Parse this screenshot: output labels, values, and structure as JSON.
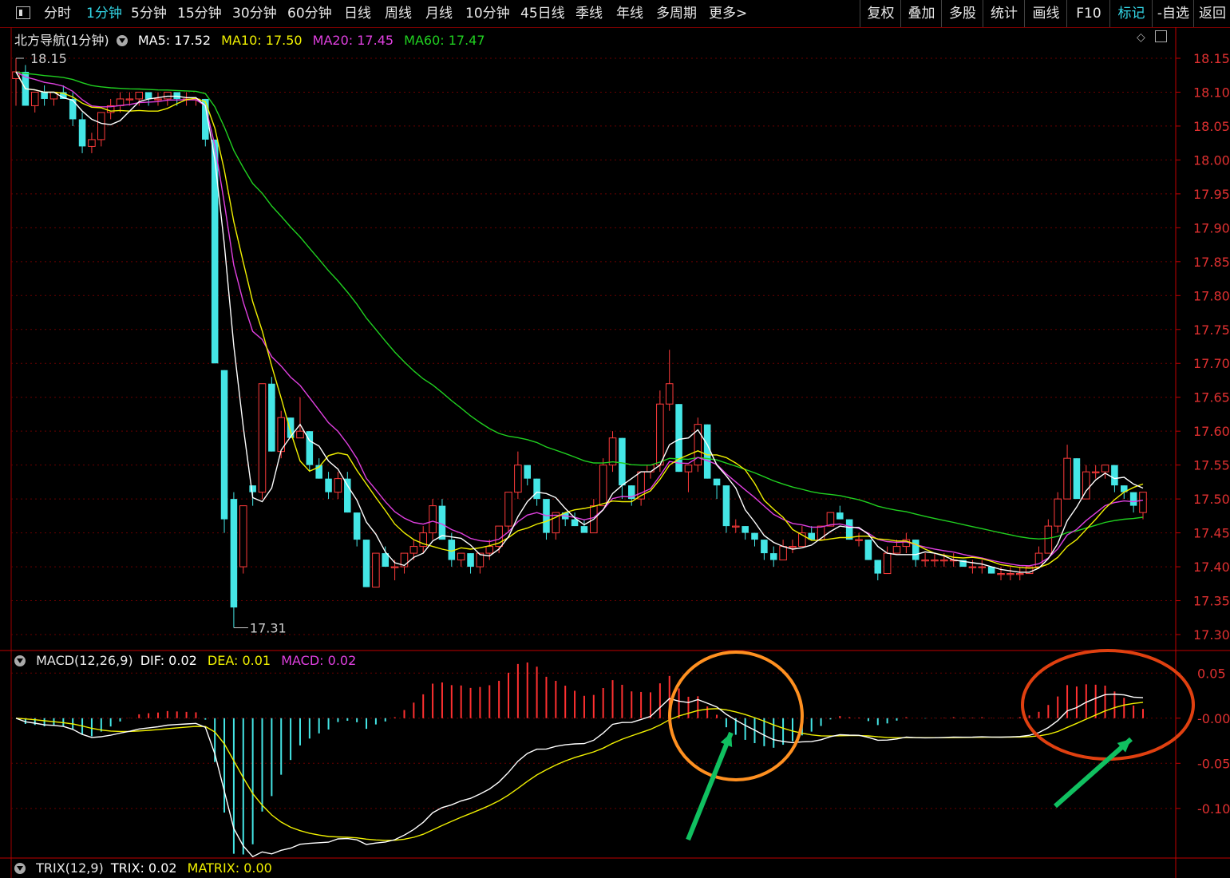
{
  "toolbar": {
    "items": [
      {
        "label": "分时",
        "active": false
      },
      {
        "label": "1分钟",
        "active": true
      },
      {
        "label": "5分钟",
        "active": false
      },
      {
        "label": "15分钟",
        "active": false
      },
      {
        "label": "30分钟",
        "active": false
      },
      {
        "label": "60分钟",
        "active": false
      },
      {
        "label": "日线",
        "active": false
      },
      {
        "label": "周线",
        "active": false
      },
      {
        "label": "月线",
        "active": false
      },
      {
        "label": "10分钟",
        "active": false
      },
      {
        "label": "45日线",
        "active": false
      },
      {
        "label": "季线",
        "active": false
      },
      {
        "label": "年线",
        "active": false
      },
      {
        "label": "多周期",
        "active": false
      },
      {
        "label": "更多>",
        "active": false
      }
    ],
    "right_items": [
      {
        "label": "复权",
        "active": false
      },
      {
        "label": "叠加",
        "active": false
      },
      {
        "label": "多股",
        "active": false
      },
      {
        "label": "统计",
        "active": false
      },
      {
        "label": "画线",
        "active": false
      },
      {
        "label": "F10",
        "active": false
      },
      {
        "label": "标记",
        "active": true
      },
      {
        "label": "-自选",
        "active": false
      },
      {
        "label": "返回",
        "active": false
      }
    ]
  },
  "price_panel": {
    "stock_name": "北方导航(1分钟)",
    "ma5": "MA5: 17.52",
    "ma10": "MA10: 17.50",
    "ma20": "MA20: 17.45",
    "ma60": "MA60: 17.47",
    "high_marker": "18.15",
    "low_marker": "17.31",
    "colors": {
      "up": "#ff3b3b",
      "down": "#44e6e6",
      "ma5": "#ffffff",
      "ma10": "#f0f000",
      "ma20": "#e040e0",
      "ma60": "#20d020"
    }
  },
  "macd_panel": {
    "title": "MACD(12,26,9)",
    "dif": "DIF: 0.02",
    "dea": "DEA: 0.01",
    "macd": "MACD: 0.02"
  },
  "trix_panel": {
    "title": "TRIX(12,9)",
    "trix": "TRIX: 0.02",
    "matrix": "MATRIX: 0.00"
  },
  "chart_data": [
    {
      "type": "candlestick",
      "title": "北方导航(1分钟)",
      "ylim": [
        17.28,
        18.17
      ],
      "y_ticks": [
        "18.15",
        "18.10",
        "18.05",
        "18.00",
        "17.95",
        "17.90",
        "17.85",
        "17.80",
        "17.75",
        "17.70",
        "17.65",
        "17.60",
        "17.55",
        "17.50",
        "17.45",
        "17.40",
        "17.35",
        "17.30"
      ],
      "ohlc": [
        [
          18.12,
          18.15,
          18.08,
          18.13
        ],
        [
          18.13,
          18.14,
          18.08,
          18.08
        ],
        [
          18.08,
          18.1,
          18.07,
          18.1
        ],
        [
          18.1,
          18.11,
          18.08,
          18.09
        ],
        [
          18.09,
          18.1,
          18.08,
          18.1
        ],
        [
          18.1,
          18.11,
          18.09,
          18.09
        ],
        [
          18.09,
          18.1,
          18.05,
          18.06
        ],
        [
          18.06,
          18.07,
          18.01,
          18.02
        ],
        [
          18.02,
          18.04,
          18.01,
          18.03
        ],
        [
          18.03,
          18.07,
          18.02,
          18.07
        ],
        [
          18.07,
          18.09,
          18.06,
          18.08
        ],
        [
          18.08,
          18.1,
          18.07,
          18.09
        ],
        [
          18.09,
          18.1,
          18.08,
          18.09
        ],
        [
          18.09,
          18.1,
          18.08,
          18.1
        ],
        [
          18.1,
          18.1,
          18.08,
          18.09
        ],
        [
          18.09,
          18.1,
          18.08,
          18.09
        ],
        [
          18.09,
          18.1,
          18.08,
          18.1
        ],
        [
          18.1,
          18.1,
          18.08,
          18.09
        ],
        [
          18.09,
          18.1,
          18.08,
          18.09
        ],
        [
          18.09,
          18.09,
          18.08,
          18.09
        ],
        [
          18.09,
          18.09,
          18.02,
          18.03
        ],
        [
          18.03,
          18.03,
          17.7,
          17.7
        ],
        [
          17.69,
          17.69,
          17.45,
          17.47
        ],
        [
          17.5,
          17.51,
          17.31,
          17.34
        ],
        [
          17.4,
          17.49,
          17.39,
          17.49
        ],
        [
          17.52,
          17.52,
          17.49,
          17.51
        ],
        [
          17.51,
          17.67,
          17.5,
          17.67
        ],
        [
          17.67,
          17.68,
          17.57,
          17.57
        ],
        [
          17.57,
          17.63,
          17.56,
          17.62
        ],
        [
          17.62,
          17.62,
          17.59,
          17.59
        ],
        [
          17.59,
          17.65,
          17.59,
          17.6
        ],
        [
          17.6,
          17.6,
          17.54,
          17.55
        ],
        [
          17.55,
          17.56,
          17.53,
          17.53
        ],
        [
          17.53,
          17.54,
          17.5,
          17.51
        ],
        [
          17.51,
          17.54,
          17.5,
          17.53
        ],
        [
          17.53,
          17.54,
          17.48,
          17.48
        ],
        [
          17.48,
          17.48,
          17.43,
          17.44
        ],
        [
          17.44,
          17.44,
          17.37,
          17.37
        ],
        [
          17.37,
          17.42,
          17.37,
          17.42
        ],
        [
          17.42,
          17.43,
          17.4,
          17.4
        ],
        [
          17.4,
          17.41,
          17.38,
          17.4
        ],
        [
          17.4,
          17.42,
          17.39,
          17.42
        ],
        [
          17.42,
          17.44,
          17.41,
          17.43
        ],
        [
          17.43,
          17.46,
          17.42,
          17.45
        ],
        [
          17.45,
          17.5,
          17.44,
          17.49
        ],
        [
          17.49,
          17.5,
          17.44,
          17.44
        ],
        [
          17.44,
          17.45,
          17.4,
          17.41
        ],
        [
          17.41,
          17.42,
          17.4,
          17.42
        ],
        [
          17.42,
          17.42,
          17.39,
          17.4
        ],
        [
          17.4,
          17.42,
          17.39,
          17.42
        ],
        [
          17.42,
          17.44,
          17.41,
          17.43
        ],
        [
          17.43,
          17.46,
          17.42,
          17.46
        ],
        [
          17.46,
          17.51,
          17.45,
          17.51
        ],
        [
          17.51,
          17.57,
          17.5,
          17.55
        ],
        [
          17.55,
          17.55,
          17.52,
          17.53
        ],
        [
          17.53,
          17.53,
          17.49,
          17.5
        ],
        [
          17.5,
          17.5,
          17.44,
          17.45
        ],
        [
          17.45,
          17.48,
          17.44,
          17.48
        ],
        [
          17.48,
          17.48,
          17.46,
          17.47
        ],
        [
          17.47,
          17.48,
          17.46,
          17.46
        ],
        [
          17.46,
          17.47,
          17.45,
          17.45
        ],
        [
          17.45,
          17.5,
          17.45,
          17.49
        ],
        [
          17.49,
          17.56,
          17.49,
          17.55
        ],
        [
          17.55,
          17.6,
          17.54,
          17.59
        ],
        [
          17.59,
          17.59,
          17.5,
          17.52
        ],
        [
          17.52,
          17.52,
          17.49,
          17.5
        ],
        [
          17.5,
          17.54,
          17.49,
          17.54
        ],
        [
          17.54,
          17.55,
          17.53,
          17.55
        ],
        [
          17.55,
          17.66,
          17.54,
          17.64
        ],
        [
          17.64,
          17.72,
          17.63,
          17.67
        ],
        [
          17.64,
          17.64,
          17.54,
          17.54
        ],
        [
          17.54,
          17.55,
          17.51,
          17.55
        ],
        [
          17.55,
          17.62,
          17.54,
          17.61
        ],
        [
          17.61,
          17.61,
          17.53,
          17.53
        ],
        [
          17.53,
          17.53,
          17.5,
          17.52
        ],
        [
          17.52,
          17.52,
          17.45,
          17.46
        ],
        [
          17.46,
          17.47,
          17.45,
          17.46
        ],
        [
          17.46,
          17.46,
          17.44,
          17.45
        ],
        [
          17.45,
          17.45,
          17.43,
          17.44
        ],
        [
          17.44,
          17.44,
          17.41,
          17.42
        ],
        [
          17.42,
          17.43,
          17.4,
          17.41
        ],
        [
          17.41,
          17.44,
          17.41,
          17.43
        ],
        [
          17.43,
          17.44,
          17.42,
          17.43
        ],
        [
          17.43,
          17.46,
          17.43,
          17.45
        ],
        [
          17.45,
          17.46,
          17.44,
          17.44
        ],
        [
          17.44,
          17.46,
          17.44,
          17.46
        ],
        [
          17.46,
          17.48,
          17.46,
          17.48
        ],
        [
          17.48,
          17.49,
          17.47,
          17.47
        ],
        [
          17.47,
          17.47,
          17.44,
          17.44
        ],
        [
          17.44,
          17.45,
          17.43,
          17.44
        ],
        [
          17.44,
          17.44,
          17.41,
          17.41
        ],
        [
          17.41,
          17.41,
          17.38,
          17.39
        ],
        [
          17.39,
          17.43,
          17.39,
          17.42
        ],
        [
          17.42,
          17.44,
          17.42,
          17.43
        ],
        [
          17.43,
          17.45,
          17.42,
          17.44
        ],
        [
          17.44,
          17.44,
          17.4,
          17.41
        ],
        [
          17.41,
          17.42,
          17.4,
          17.41
        ],
        [
          17.41,
          17.42,
          17.4,
          17.41
        ],
        [
          17.41,
          17.42,
          17.4,
          17.41
        ],
        [
          17.41,
          17.42,
          17.4,
          17.41
        ],
        [
          17.41,
          17.41,
          17.4,
          17.4
        ],
        [
          17.4,
          17.41,
          17.39,
          17.4
        ],
        [
          17.4,
          17.41,
          17.39,
          17.4
        ],
        [
          17.4,
          17.4,
          17.39,
          17.39
        ],
        [
          17.39,
          17.4,
          17.38,
          17.39
        ],
        [
          17.39,
          17.4,
          17.38,
          17.39
        ],
        [
          17.39,
          17.4,
          17.38,
          17.39
        ],
        [
          17.39,
          17.4,
          17.39,
          17.4
        ],
        [
          17.4,
          17.43,
          17.4,
          17.42
        ],
        [
          17.42,
          17.47,
          17.42,
          17.46
        ],
        [
          17.46,
          17.51,
          17.45,
          17.5
        ],
        [
          17.5,
          17.58,
          17.5,
          17.56
        ],
        [
          17.56,
          17.56,
          17.5,
          17.5
        ],
        [
          17.5,
          17.55,
          17.5,
          17.54
        ],
        [
          17.54,
          17.55,
          17.53,
          17.54
        ],
        [
          17.54,
          17.55,
          17.53,
          17.55
        ],
        [
          17.55,
          17.55,
          17.51,
          17.52
        ],
        [
          17.52,
          17.52,
          17.5,
          17.51
        ],
        [
          17.51,
          17.51,
          17.48,
          17.49
        ],
        [
          17.48,
          17.51,
          17.47,
          17.51
        ]
      ]
    },
    {
      "type": "line",
      "title": "MACD(12,26,9)",
      "ylim": [
        -0.155,
        0.075
      ],
      "y_ticks": [
        "0.05",
        "-0.00",
        "-0.05",
        "-0.10"
      ],
      "series": [
        {
          "name": "DIF",
          "color": "#ffffff"
        },
        {
          "name": "DEA",
          "color": "#f0f000"
        },
        {
          "name": "MACD",
          "color": "#e040e0"
        }
      ]
    }
  ]
}
